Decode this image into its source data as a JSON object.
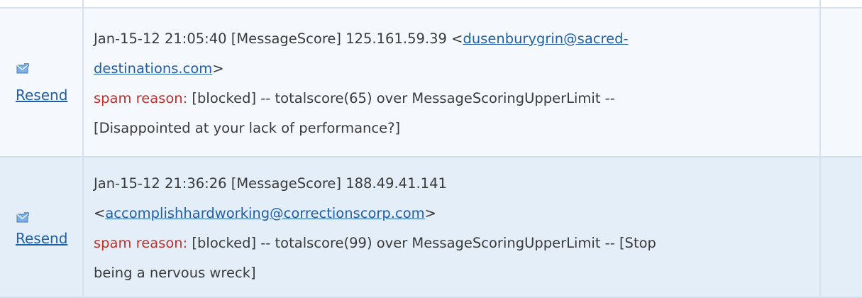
{
  "rows": [
    {
      "action_label": "Resend",
      "icon": "mail-resend-icon",
      "line1_prefix": "Jan-15-12 21:05:40 [MessageScore] 125.161.59.39 <",
      "email_part1": "dusenburygrin@sacred-",
      "email_part2": "destinations.com",
      "line2_suffix": ">",
      "reason_label": "spam reason:",
      "reason_text": " [blocked] -- totalscore(65) over MessageScoringUpperLimit --",
      "reason_text2": "[Disappointed at your lack of performance?]"
    },
    {
      "action_label": "Resend",
      "icon": "mail-resend-icon",
      "line1": "Jan-15-12 21:36:26 [MessageScore] 188.49.41.141",
      "line2_prefix": "<",
      "email": "accomplishhardworking@correctionscorp.com",
      "line2_suffix": ">",
      "reason_label": "spam reason:",
      "reason_text": " [blocked] -- totalscore(99) over MessageScoringUpperLimit -- [Stop",
      "reason_text2": "being a nervous wreck]"
    }
  ],
  "colors": {
    "row1_bg": "#f5f9fd",
    "row2_bg": "#e4eef8",
    "link": "#1f5fa8",
    "reason_label": "#c0302a",
    "text": "#3a3a3a"
  }
}
